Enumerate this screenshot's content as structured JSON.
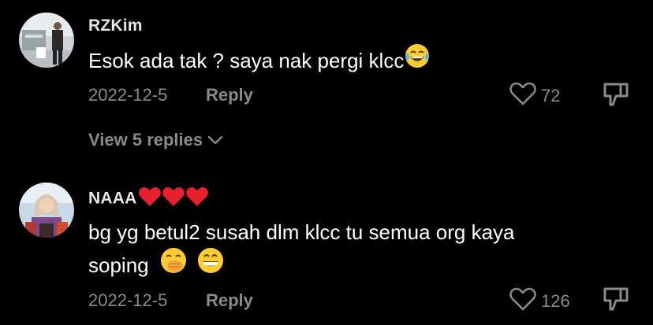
{
  "comments": [
    {
      "username": "RZKim",
      "text": "Esok ada tak ? saya nak pergi klcc",
      "date": "2022-12-5",
      "reply_label": "Reply",
      "likes": "72",
      "view_replies": "View 5 replies",
      "emoji": [
        "joy-emoji"
      ]
    },
    {
      "username": "NAAA",
      "username_emoji": [
        "red-heart-emoji",
        "red-heart-emoji",
        "red-heart-emoji"
      ],
      "text_line1": "bg yg betul2 susah dlm klcc tu semua org kaya",
      "text_line2": "soping",
      "date": "2022-12-5",
      "reply_label": "Reply",
      "likes": "126",
      "emoji": [
        "hand-over-mouth-emoji",
        "grinning-emoji"
      ]
    }
  ],
  "colors": {
    "background": "#000000",
    "text": "#ffffff",
    "muted": "#8a8a8a",
    "heart": "#e8202e",
    "emoji_yellow": "#ffcc33"
  }
}
